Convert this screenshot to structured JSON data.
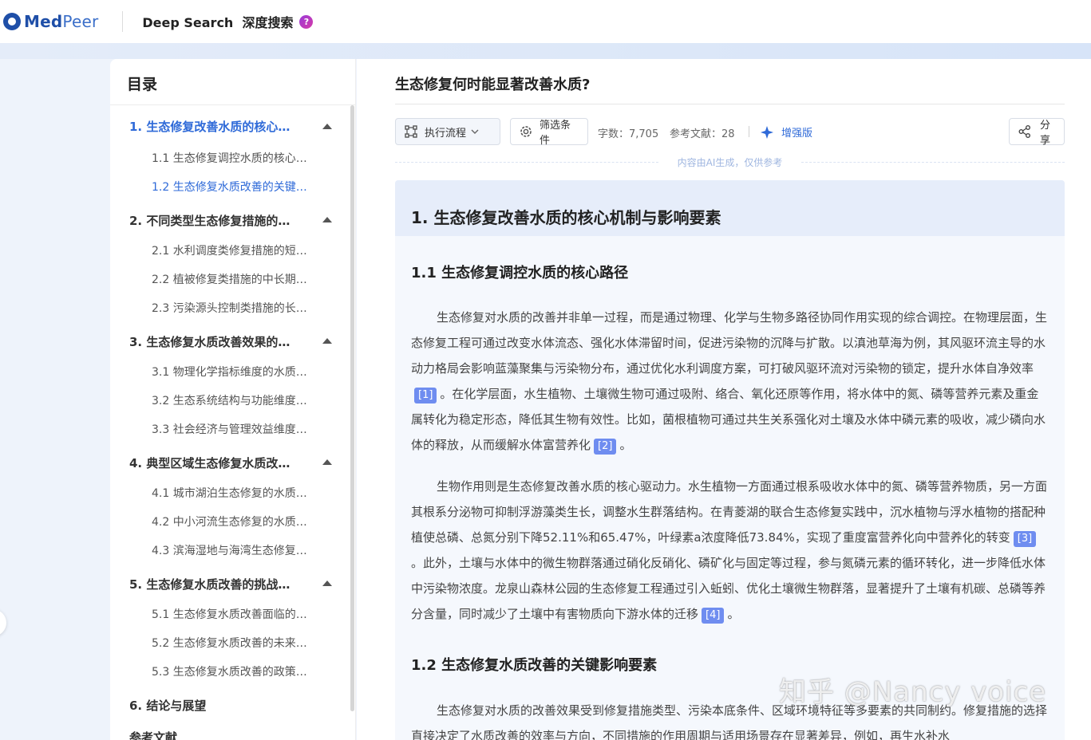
{
  "header": {
    "brand_a": "Med",
    "brand_b": "Peer",
    "product": "Deep Search  深度搜索",
    "help": "?"
  },
  "toc": {
    "title": "目录",
    "sections": [
      {
        "label": "1. 生态修复改善水质的核心…",
        "active": true,
        "items": [
          {
            "label": "1.1 生态修复调控水质的核心…"
          },
          {
            "label": "1.2 生态修复水质改善的关键…",
            "active": true
          }
        ]
      },
      {
        "label": "2. 不同类型生态修复措施的…",
        "items": [
          {
            "label": "2.1 水利调度类修复措施的短…"
          },
          {
            "label": "2.2 植被修复类措施的中长期…"
          },
          {
            "label": "2.3 污染源头控制类措施的长…"
          }
        ]
      },
      {
        "label": "3. 生态修复水质改善效果的…",
        "items": [
          {
            "label": "3.1 物理化学指标维度的水质…"
          },
          {
            "label": "3.2 生态系统结构与功能维度…"
          },
          {
            "label": "3.3 社会经济与管理效益维度…"
          }
        ]
      },
      {
        "label": "4. 典型区域生态修复水质改…",
        "items": [
          {
            "label": "4.1 城市湖泊生态修复的水质…"
          },
          {
            "label": "4.2 中小河流生态修复的水质…"
          },
          {
            "label": "4.3 滨海湿地与海湾生态修复…"
          }
        ]
      },
      {
        "label": "5. 生态修复水质改善的挑战…",
        "items": [
          {
            "label": "5.1 生态修复水质改善面临的…"
          },
          {
            "label": "5.2 生态修复水质改善的未来…"
          },
          {
            "label": "5.3 生态修复水质改善的政策…"
          }
        ]
      },
      {
        "label": "6. 结论与展望",
        "items": []
      },
      {
        "label": "参考文献",
        "items": []
      }
    ]
  },
  "main": {
    "question": "生态修复何时能显著改善水质?",
    "toolbar": {
      "flow_label": "执行流程",
      "filter_label": "筛选条件",
      "word_count": "字数：7,705",
      "refs": "参考文献：28",
      "enhanced": "增强版",
      "share": "分享"
    },
    "ai_note": "内容由AI生成，仅供参考",
    "h1": "1. 生态修复改善水质的核心机制与影响要素",
    "h2_1": "1.1 生态修复调控水质的核心路径",
    "p1": {
      "a": "生态修复对水质的改善并非单一过程，而是通过物理、化学与生物多路径协同作用实现的综合调控。在物理层面，生态修复工程可通过改变水体流态、强化水体滞留时间，促进污染物的沉降与扩散。以滇池草海为例，其风驱环流主导的水动力格局会影响蓝藻聚集与污染物分布，通过优化水利调度方案，可打破风驱环流对污染物的锁定，提升水体自净效率",
      "c1": "[1]",
      "b": "。在化学层面，水生植物、土壤微生物可通过吸附、络合、氧化还原等作用，将水体中的氮、磷等营养元素及重金属转化为稳定形态，降低其生物有效性。比如，菌根植物可通过共生关系强化对土壤及水体中磷元素的吸收，减少磷向水体的释放，从而缓解水体富营养化",
      "c2": "[2]",
      "end": "。"
    },
    "p2": {
      "a": "生物作用则是生态修复改善水质的核心驱动力。水生植物一方面通过根系吸收水体中的氮、磷等营养物质，另一方面其根系分泌物可抑制浮游藻类生长，调整水生群落结构。在青菱湖的联合生态修复实践中，沉水植物与浮水植物的搭配种植使总磷、总氮分别下降52.11%和65.47%，叶绿素a浓度降低73.84%，实现了重度富营养化向中营养化的转变",
      "c3": "[3]",
      "b": "。此外，土壤与水体中的微生物群落通过硝化反硝化、磷矿化与固定等过程，参与氮磷元素的循环转化，进一步降低水体中污染物浓度。龙泉山森林公园的生态修复工程通过引入蚯蚓、优化土壤微生物群落，显著提升了土壤有机碳、总磷等养分含量，同时减少了土壤中有害物质向下游水体的迁移",
      "c4": "[4]",
      "end": "。"
    },
    "h2_2": "1.2 生态修复水质改善的关键影响要素",
    "p3": "生态修复对水质的改善效果受到修复措施类型、污染本底条件、区域环境特征等多要素的共同制约。修复措施的选择直接决定了水质改善的效率与方向，不同措施的作用周期与适用场景存在显著差异，例如，再生水补水"
  },
  "watermark": "知乎 @Nancy voice",
  "colors": {
    "accent": "#2f6ad8",
    "citation": "#6f8df0",
    "section_bg": "#e6edfa"
  }
}
